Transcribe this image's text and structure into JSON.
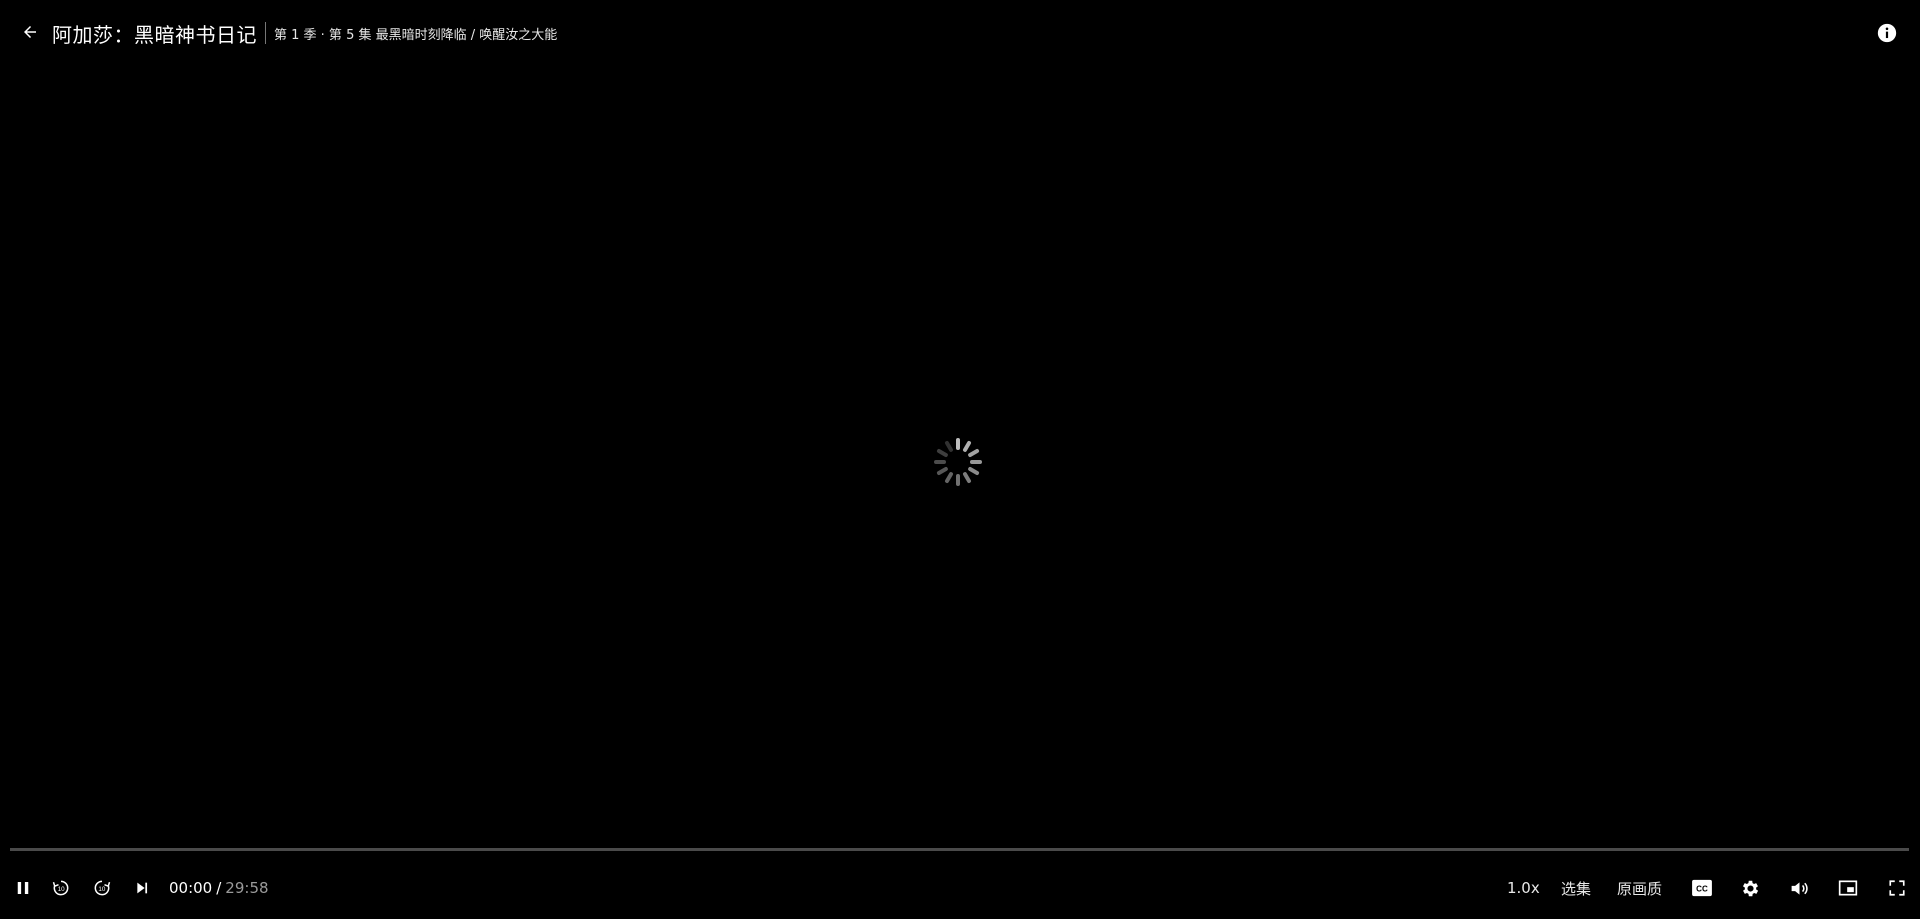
{
  "header": {
    "show_title": "阿加莎：黑暗神书日记",
    "episode_title": "第 1 季 · 第 5 集 最黑暗时刻降临 / 唤醒汝之大能"
  },
  "playback": {
    "current_time": "00:00",
    "separator": "/",
    "duration": "29:58",
    "progress": 0,
    "state": "loading"
  },
  "controls": {
    "speed_label": "1.0x",
    "episodes_label": "选集",
    "quality_label": "原画质"
  },
  "icons": {
    "back": "arrow-left-icon",
    "info": "info-icon",
    "pause": "pause-icon",
    "rewind": "rewind-10-icon",
    "forward": "forward-10-icon",
    "next": "next-episode-icon",
    "subtitles": "cc-icon",
    "settings": "gear-icon",
    "volume": "volume-icon",
    "pip": "picture-in-picture-icon",
    "fullscreen": "fullscreen-icon"
  },
  "colors": {
    "background": "#000000",
    "text": "#ffffff",
    "muted_text": "#9a9a9a",
    "progress_track": "#4a4a4a"
  }
}
